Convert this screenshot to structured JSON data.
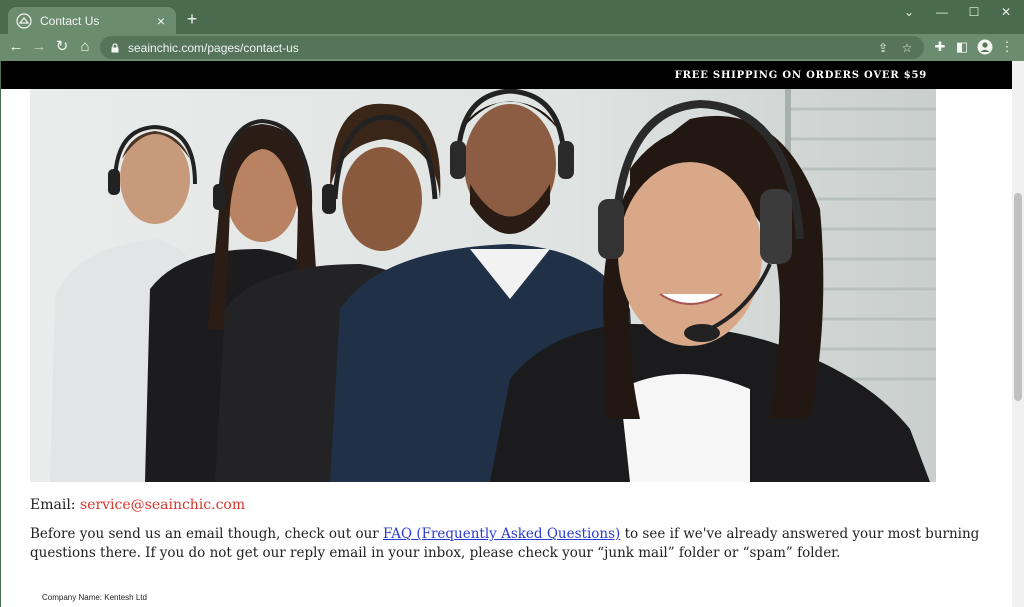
{
  "browser": {
    "tab_title": "Contact Us",
    "tab_close": "×",
    "new_tab": "+",
    "url": "seainchic.com/pages/contact-us",
    "window_controls": {
      "collapse": "⌄",
      "minimize": "—",
      "maximize": "☐",
      "close": "✕"
    }
  },
  "page": {
    "announcement": "FREE SHIPPING ON ORDERS OVER $59",
    "hero_icon": "team-photo-icon",
    "email_label": "Email:",
    "email_address": "service@seainchic.com",
    "body_before_link": "Before you send us an email though, check out our ",
    "faq_link": "FAQ (Frequently Asked Questions)",
    "body_after_link": " to see if we've already answered your most burning questions there. If you do not get our reply email in your inbox, please check your “junk mail” folder or “spam” folder.",
    "company_name": "Company Name: Kentesh Ltd"
  },
  "colors": {
    "chrome_dark": "#4b6b4f",
    "chrome_light": "#6b8c6e",
    "email_link": "#d9362b",
    "faq_link": "#2b3bd1"
  }
}
